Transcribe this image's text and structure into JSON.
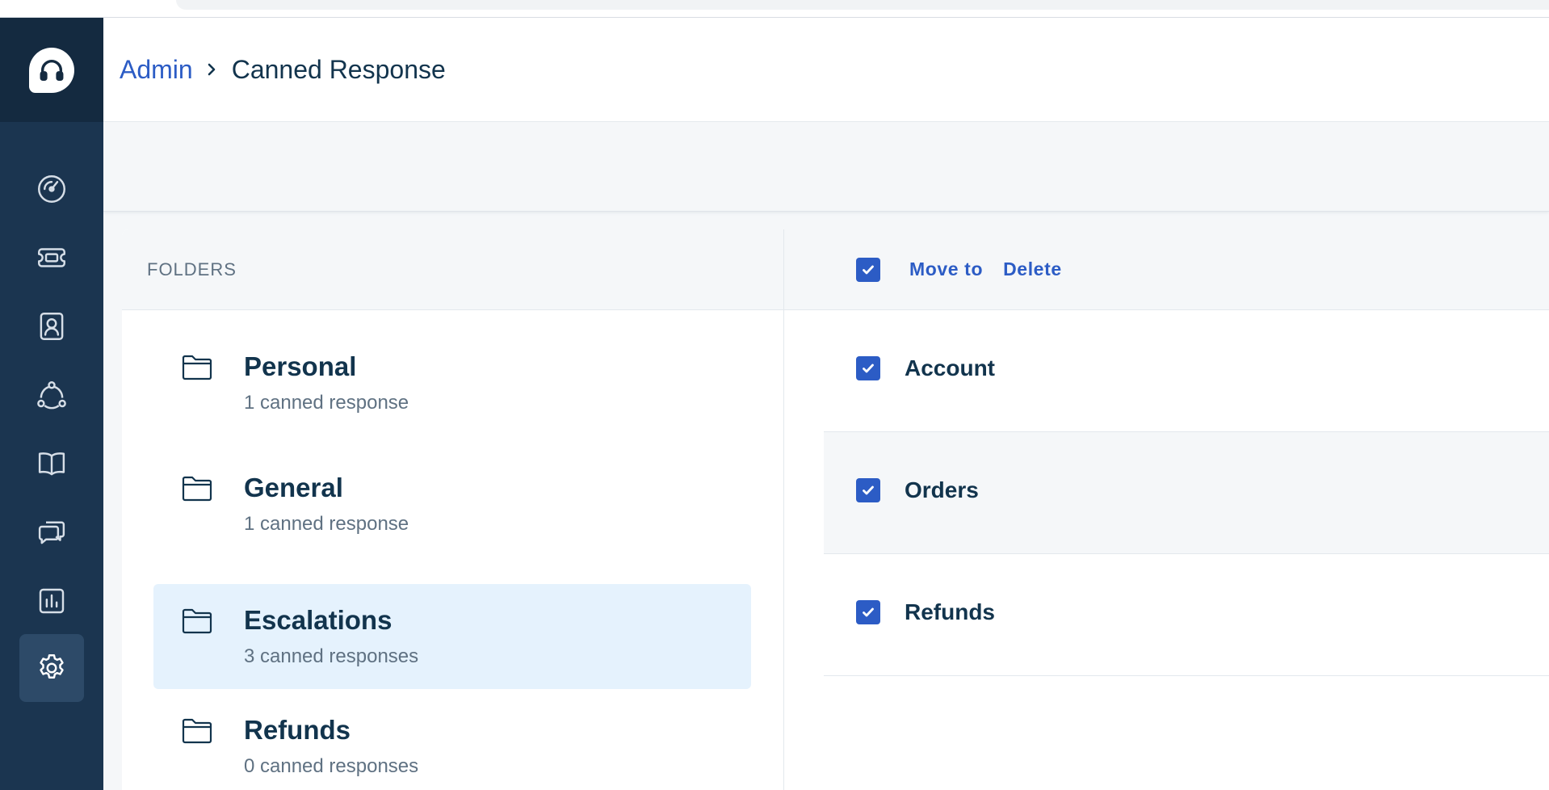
{
  "sidebar": {
    "logo_icon": "headset-icon",
    "items": [
      {
        "icon": "dashboard-icon",
        "active": false
      },
      {
        "icon": "ticket-icon",
        "active": false
      },
      {
        "icon": "contacts-icon",
        "active": false
      },
      {
        "icon": "social-icon",
        "active": false
      },
      {
        "icon": "book-icon",
        "active": false
      },
      {
        "icon": "conversations-icon",
        "active": false
      },
      {
        "icon": "reports-icon",
        "active": false
      },
      {
        "icon": "gear-icon",
        "active": true
      }
    ]
  },
  "header": {
    "breadcrumb_root": "Admin",
    "breadcrumb_current": "Canned Response"
  },
  "folders": {
    "heading": "FOLDERS",
    "items": [
      {
        "name": "Personal",
        "count": "1 canned response",
        "selected": false
      },
      {
        "name": "General",
        "count": "1 canned response",
        "selected": false
      },
      {
        "name": "Escalations",
        "count": "3 canned responses",
        "selected": true
      },
      {
        "name": "Refunds",
        "count": "0 canned responses",
        "selected": false
      }
    ]
  },
  "responses": {
    "select_all_checked": true,
    "move_to_label": "Move to",
    "delete_label": "Delete",
    "rows": [
      {
        "title": "Account",
        "checked": true
      },
      {
        "title": "Orders",
        "checked": true
      },
      {
        "title": "Refunds",
        "checked": true
      }
    ]
  },
  "colors": {
    "sidebar": "#1b3550",
    "accent": "#2c5cc5",
    "selected_folder": "#e5f2fd",
    "text": "#12344d",
    "muted": "#5f7182"
  }
}
